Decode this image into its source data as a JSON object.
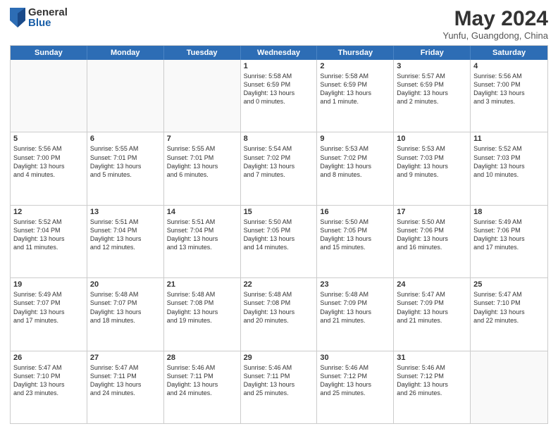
{
  "logo": {
    "general": "General",
    "blue": "Blue"
  },
  "title": "May 2024",
  "subtitle": "Yunfu, Guangdong, China",
  "headers": [
    "Sunday",
    "Monday",
    "Tuesday",
    "Wednesday",
    "Thursday",
    "Friday",
    "Saturday"
  ],
  "weeks": [
    [
      {
        "day": "",
        "text": ""
      },
      {
        "day": "",
        "text": ""
      },
      {
        "day": "",
        "text": ""
      },
      {
        "day": "1",
        "text": "Sunrise: 5:58 AM\nSunset: 6:59 PM\nDaylight: 13 hours\nand 0 minutes."
      },
      {
        "day": "2",
        "text": "Sunrise: 5:58 AM\nSunset: 6:59 PM\nDaylight: 13 hours\nand 1 minute."
      },
      {
        "day": "3",
        "text": "Sunrise: 5:57 AM\nSunset: 6:59 PM\nDaylight: 13 hours\nand 2 minutes."
      },
      {
        "day": "4",
        "text": "Sunrise: 5:56 AM\nSunset: 7:00 PM\nDaylight: 13 hours\nand 3 minutes."
      }
    ],
    [
      {
        "day": "5",
        "text": "Sunrise: 5:56 AM\nSunset: 7:00 PM\nDaylight: 13 hours\nand 4 minutes."
      },
      {
        "day": "6",
        "text": "Sunrise: 5:55 AM\nSunset: 7:01 PM\nDaylight: 13 hours\nand 5 minutes."
      },
      {
        "day": "7",
        "text": "Sunrise: 5:55 AM\nSunset: 7:01 PM\nDaylight: 13 hours\nand 6 minutes."
      },
      {
        "day": "8",
        "text": "Sunrise: 5:54 AM\nSunset: 7:02 PM\nDaylight: 13 hours\nand 7 minutes."
      },
      {
        "day": "9",
        "text": "Sunrise: 5:53 AM\nSunset: 7:02 PM\nDaylight: 13 hours\nand 8 minutes."
      },
      {
        "day": "10",
        "text": "Sunrise: 5:53 AM\nSunset: 7:03 PM\nDaylight: 13 hours\nand 9 minutes."
      },
      {
        "day": "11",
        "text": "Sunrise: 5:52 AM\nSunset: 7:03 PM\nDaylight: 13 hours\nand 10 minutes."
      }
    ],
    [
      {
        "day": "12",
        "text": "Sunrise: 5:52 AM\nSunset: 7:04 PM\nDaylight: 13 hours\nand 11 minutes."
      },
      {
        "day": "13",
        "text": "Sunrise: 5:51 AM\nSunset: 7:04 PM\nDaylight: 13 hours\nand 12 minutes."
      },
      {
        "day": "14",
        "text": "Sunrise: 5:51 AM\nSunset: 7:04 PM\nDaylight: 13 hours\nand 13 minutes."
      },
      {
        "day": "15",
        "text": "Sunrise: 5:50 AM\nSunset: 7:05 PM\nDaylight: 13 hours\nand 14 minutes."
      },
      {
        "day": "16",
        "text": "Sunrise: 5:50 AM\nSunset: 7:05 PM\nDaylight: 13 hours\nand 15 minutes."
      },
      {
        "day": "17",
        "text": "Sunrise: 5:50 AM\nSunset: 7:06 PM\nDaylight: 13 hours\nand 16 minutes."
      },
      {
        "day": "18",
        "text": "Sunrise: 5:49 AM\nSunset: 7:06 PM\nDaylight: 13 hours\nand 17 minutes."
      }
    ],
    [
      {
        "day": "19",
        "text": "Sunrise: 5:49 AM\nSunset: 7:07 PM\nDaylight: 13 hours\nand 17 minutes."
      },
      {
        "day": "20",
        "text": "Sunrise: 5:48 AM\nSunset: 7:07 PM\nDaylight: 13 hours\nand 18 minutes."
      },
      {
        "day": "21",
        "text": "Sunrise: 5:48 AM\nSunset: 7:08 PM\nDaylight: 13 hours\nand 19 minutes."
      },
      {
        "day": "22",
        "text": "Sunrise: 5:48 AM\nSunset: 7:08 PM\nDaylight: 13 hours\nand 20 minutes."
      },
      {
        "day": "23",
        "text": "Sunrise: 5:48 AM\nSunset: 7:09 PM\nDaylight: 13 hours\nand 21 minutes."
      },
      {
        "day": "24",
        "text": "Sunrise: 5:47 AM\nSunset: 7:09 PM\nDaylight: 13 hours\nand 21 minutes."
      },
      {
        "day": "25",
        "text": "Sunrise: 5:47 AM\nSunset: 7:10 PM\nDaylight: 13 hours\nand 22 minutes."
      }
    ],
    [
      {
        "day": "26",
        "text": "Sunrise: 5:47 AM\nSunset: 7:10 PM\nDaylight: 13 hours\nand 23 minutes."
      },
      {
        "day": "27",
        "text": "Sunrise: 5:47 AM\nSunset: 7:11 PM\nDaylight: 13 hours\nand 24 minutes."
      },
      {
        "day": "28",
        "text": "Sunrise: 5:46 AM\nSunset: 7:11 PM\nDaylight: 13 hours\nand 24 minutes."
      },
      {
        "day": "29",
        "text": "Sunrise: 5:46 AM\nSunset: 7:11 PM\nDaylight: 13 hours\nand 25 minutes."
      },
      {
        "day": "30",
        "text": "Sunrise: 5:46 AM\nSunset: 7:12 PM\nDaylight: 13 hours\nand 25 minutes."
      },
      {
        "day": "31",
        "text": "Sunrise: 5:46 AM\nSunset: 7:12 PM\nDaylight: 13 hours\nand 26 minutes."
      },
      {
        "day": "",
        "text": ""
      }
    ]
  ]
}
